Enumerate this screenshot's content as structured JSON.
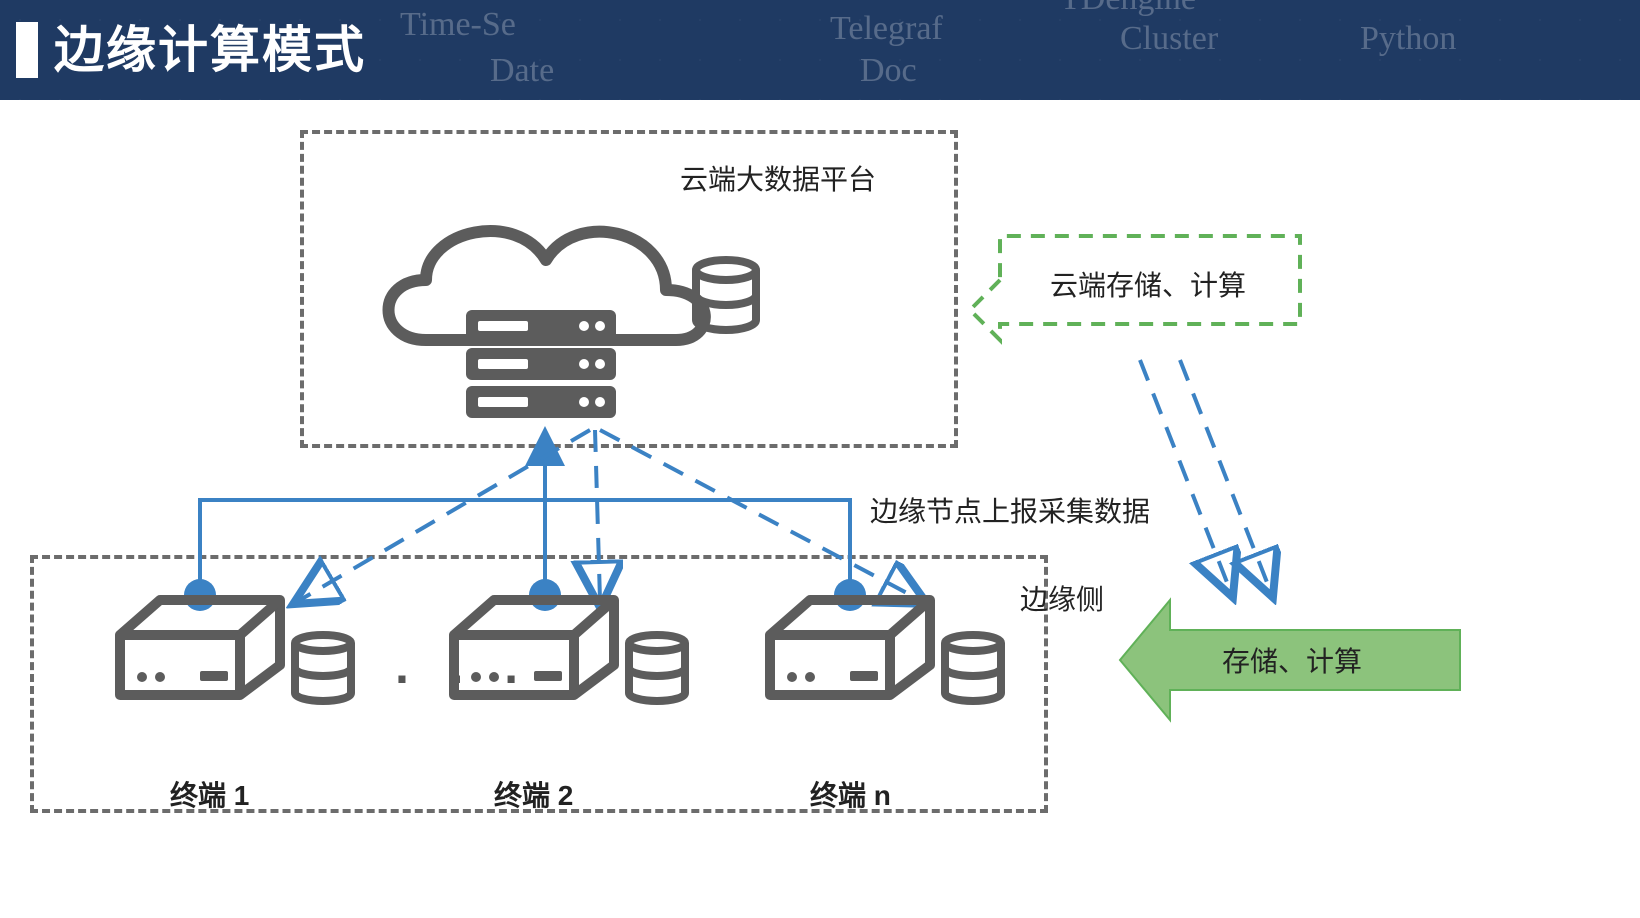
{
  "title": "边缘计算模式",
  "header_faint": [
    "Time-Se",
    "Date",
    "Telegraf",
    "Doc",
    "Cluster",
    "Python",
    "TDengine"
  ],
  "cloud": {
    "box_label": "云端大数据平台",
    "callout": "云端存储、计算"
  },
  "edge": {
    "box_label": "边缘侧",
    "report_label": "边缘节点上报采集数据",
    "callout": "存储、计算"
  },
  "terminals": {
    "t1": "终端 1",
    "t2": "终端 2",
    "tn": "终端 n",
    "ellipsis": "· · ·"
  },
  "colors": {
    "header": "#1f3a63",
    "line": "#3b82c4",
    "green_dash": "#60b158",
    "green_fill": "#8cc37c",
    "gray": "#5c5c5c"
  }
}
